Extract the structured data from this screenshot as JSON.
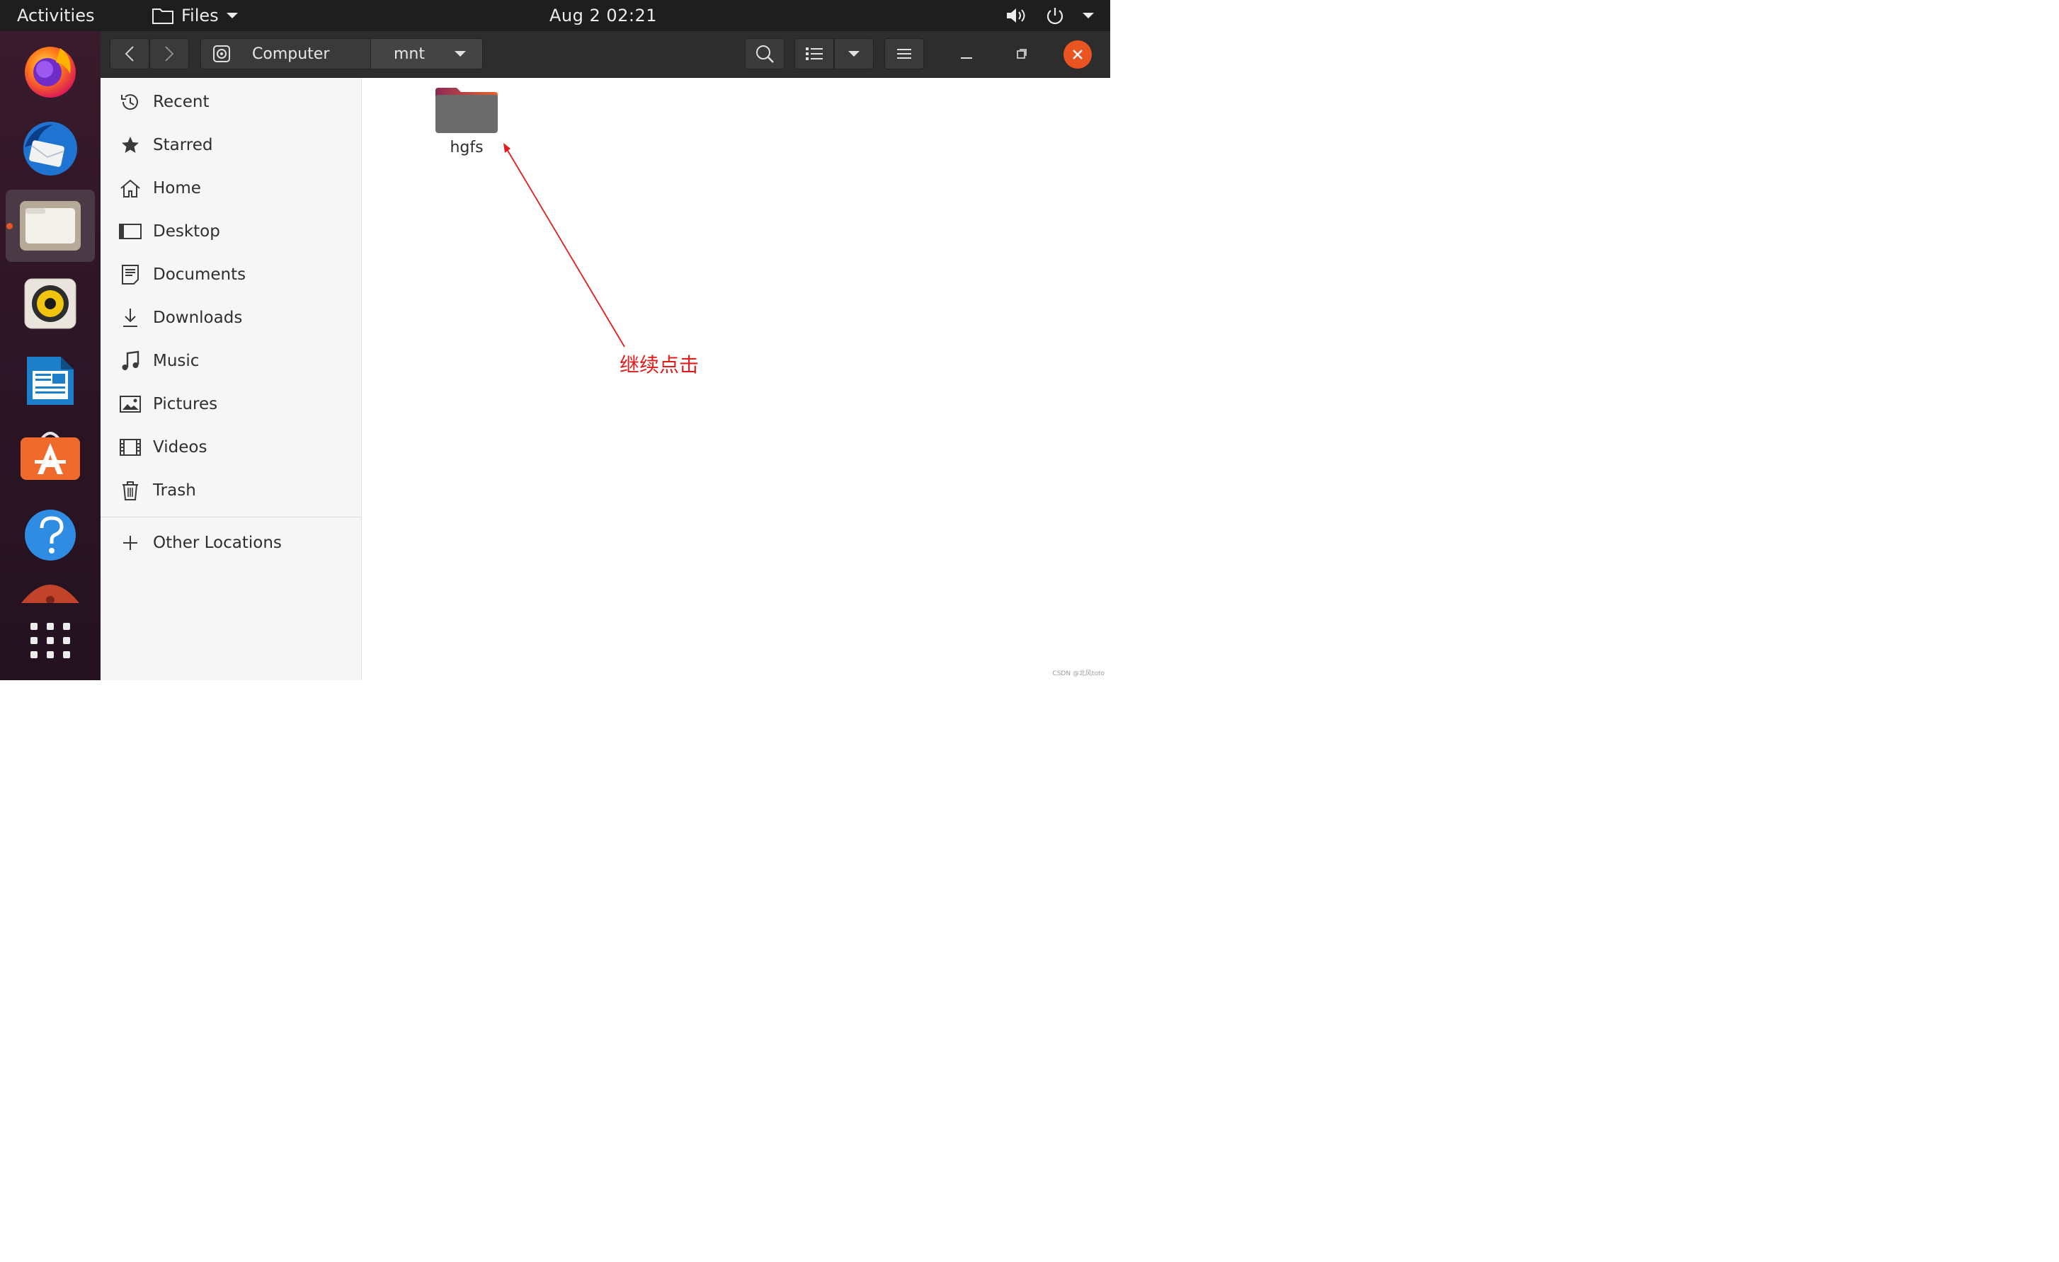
{
  "topbar": {
    "activities": "Activities",
    "app_menu": "Files",
    "clock": "Aug 2  02:21"
  },
  "dock": {
    "apps": [
      "Firefox",
      "Thunderbird",
      "Files",
      "Rhythmbox",
      "LibreOffice Writer",
      "Ubuntu Software",
      "Help",
      "Ubuntu",
      "Show Applications"
    ],
    "running_app": "Files"
  },
  "headerbar": {
    "path": [
      "Computer",
      "mnt"
    ]
  },
  "sidebar": {
    "items": [
      {
        "label": "Recent",
        "icon": "clock-icon"
      },
      {
        "label": "Starred",
        "icon": "star-icon"
      },
      {
        "label": "Home",
        "icon": "home-icon"
      },
      {
        "label": "Desktop",
        "icon": "desktop-icon"
      },
      {
        "label": "Documents",
        "icon": "document-icon"
      },
      {
        "label": "Downloads",
        "icon": "download-icon"
      },
      {
        "label": "Music",
        "icon": "music-icon"
      },
      {
        "label": "Pictures",
        "icon": "picture-icon"
      },
      {
        "label": "Videos",
        "icon": "video-icon"
      },
      {
        "label": "Trash",
        "icon": "trash-icon"
      }
    ],
    "other_locations": "Other Locations"
  },
  "content": {
    "items": [
      {
        "name": "hgfs",
        "type": "folder"
      }
    ]
  },
  "annotation": {
    "text": "继续点击",
    "color": "#e21b1b"
  },
  "watermark": "CSDN @北风toto",
  "colors": {
    "accent": "#e95420",
    "topbar": "#1e1e1e",
    "headerbar": "#2d2d2d",
    "sidebar": "#f6f6f6"
  }
}
